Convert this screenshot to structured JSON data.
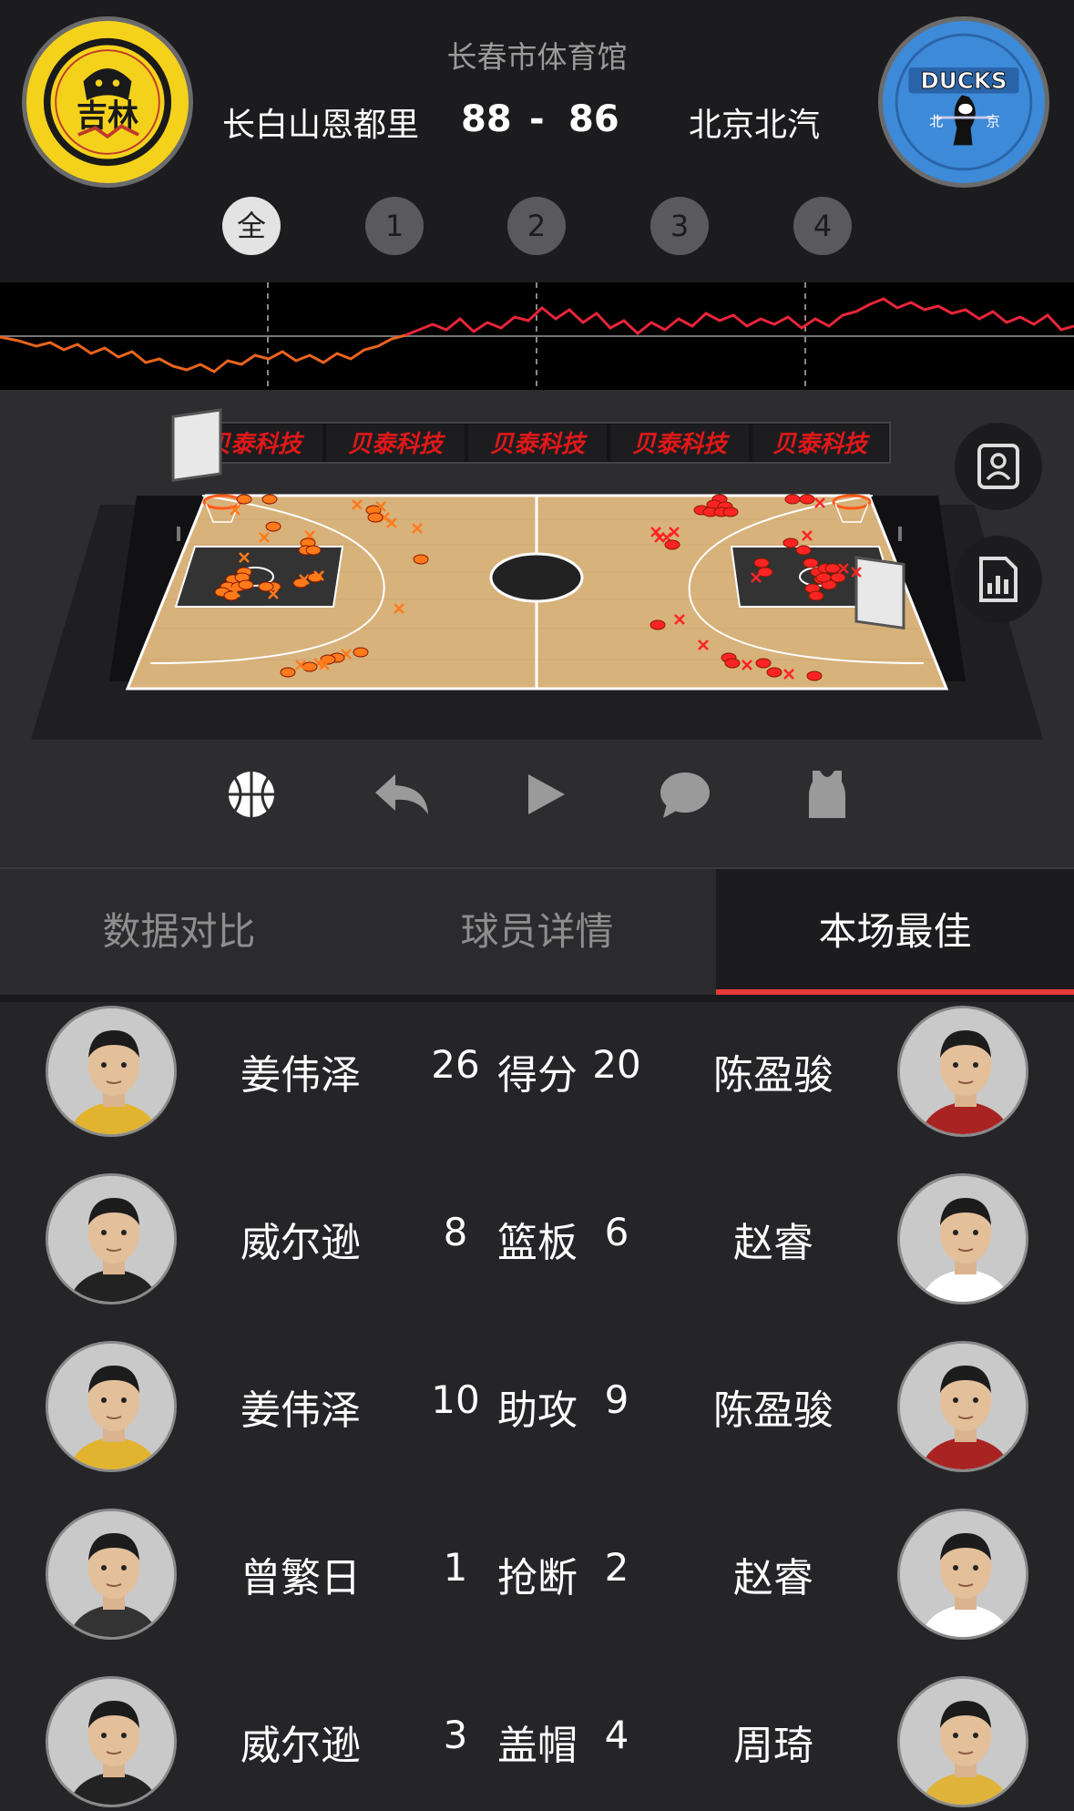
{
  "header": {
    "venue": "长春市体育馆",
    "home_team": "长白山恩都里",
    "away_team": "北京北汽",
    "home_score": "88",
    "score_separator": "-",
    "away_score": "86",
    "home_logo_text": "吉林",
    "away_logo_text": "DUCKS",
    "away_logo_subtext_left": "北",
    "away_logo_subtext_right": "京"
  },
  "quarters": [
    "全",
    "1",
    "2",
    "3",
    "4"
  ],
  "court": {
    "sponsor": "贝泰科技",
    "home_color": "#ff7a1a",
    "away_color": "#ff2424",
    "made_marker": "circle",
    "missed_marker": "x"
  },
  "side_buttons": [
    "player-card-icon",
    "stats-report-icon"
  ],
  "controls": [
    "basketball-icon",
    "undo-icon",
    "play-icon",
    "comment-icon",
    "jersey-icon"
  ],
  "tabs": [
    {
      "label": "数据对比",
      "active": false
    },
    {
      "label": "球员详情",
      "active": false
    },
    {
      "label": "本场最佳",
      "active": true
    }
  ],
  "leaders": [
    {
      "stat": "得分",
      "home_player": "姜伟泽",
      "home_value": "26",
      "away_player": "陈盈骏",
      "away_value": "20"
    },
    {
      "stat": "篮板",
      "home_player": "威尔逊",
      "home_value": "8",
      "away_player": "赵睿",
      "away_value": "6"
    },
    {
      "stat": "助攻",
      "home_player": "姜伟泽",
      "home_value": "10",
      "away_player": "陈盈骏",
      "away_value": "9"
    },
    {
      "stat": "抢断",
      "home_player": "曾繁日",
      "home_value": "1",
      "away_player": "赵睿",
      "away_value": "2"
    },
    {
      "stat": "盖帽",
      "home_player": "威尔逊",
      "home_value": "3",
      "away_player": "周琦",
      "away_value": "4"
    }
  ]
}
